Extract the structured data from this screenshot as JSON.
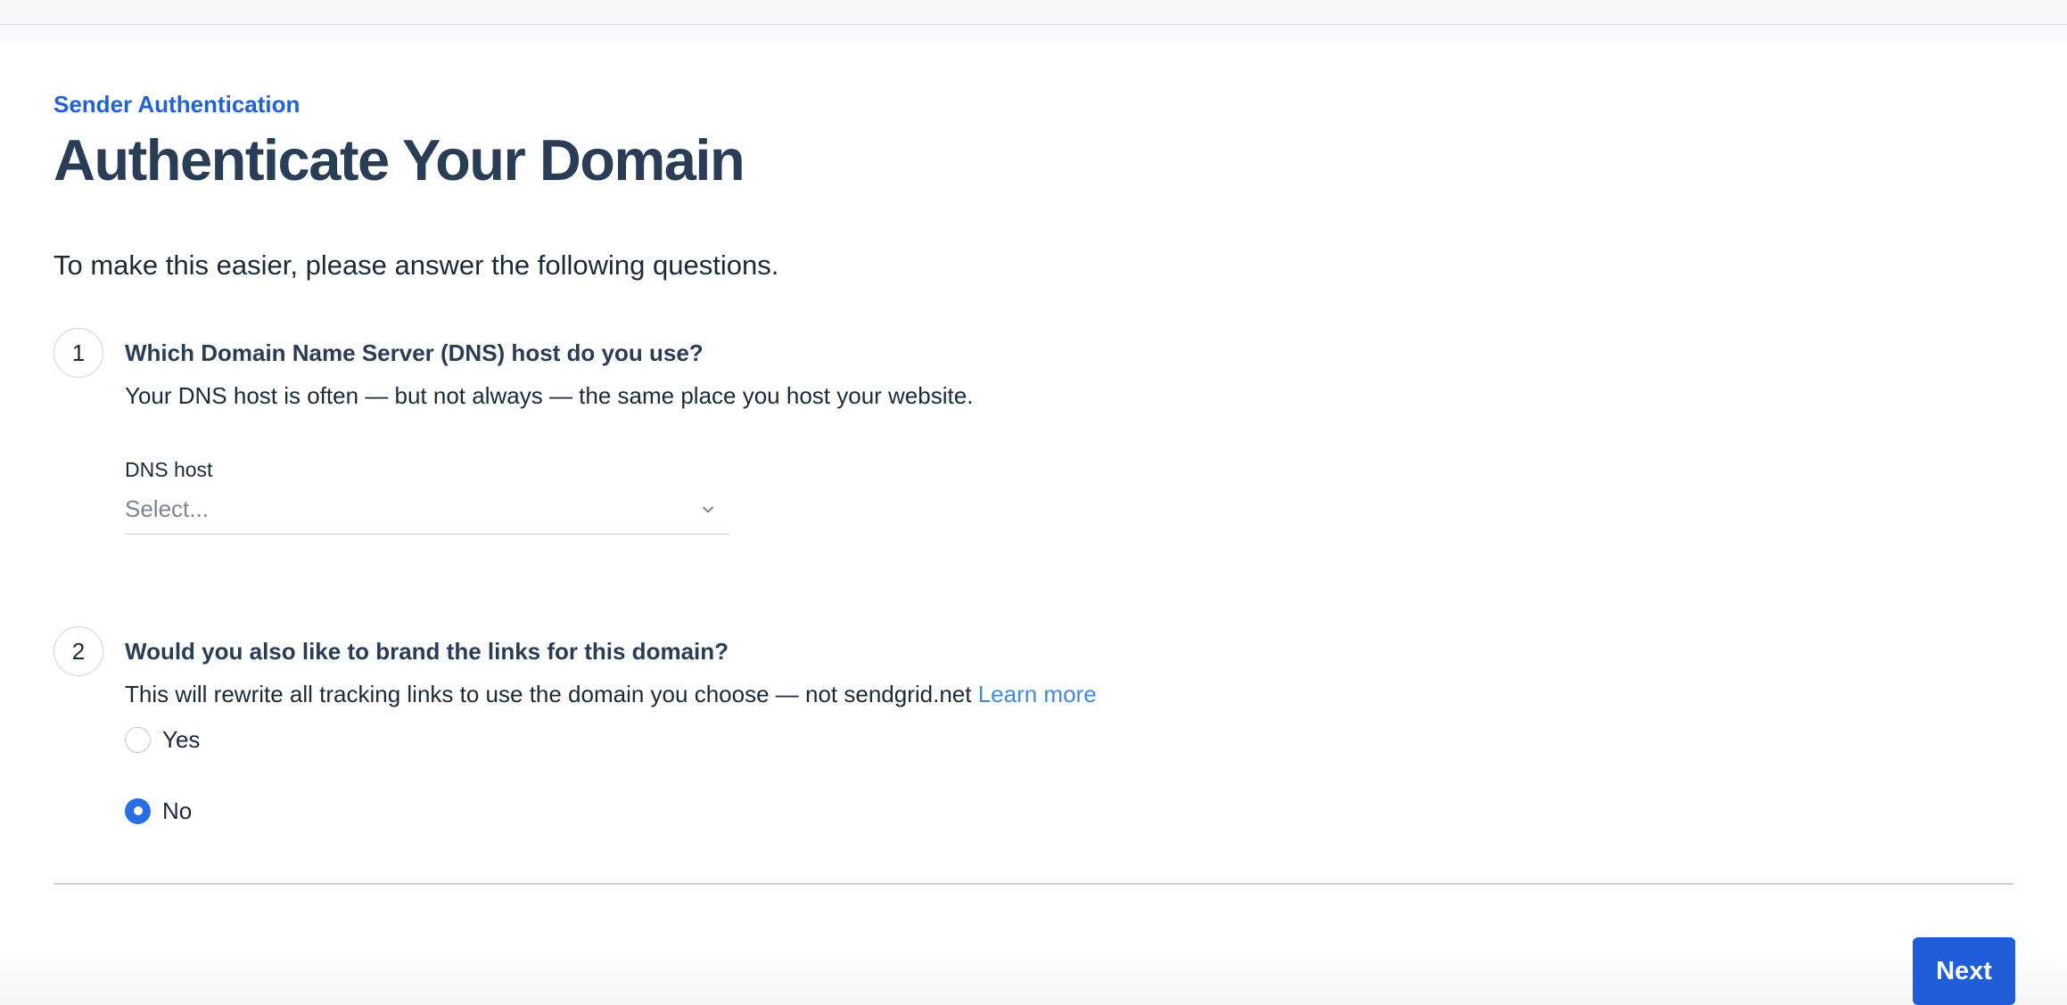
{
  "header": {
    "eyebrow": "Sender Authentication",
    "title": "Authenticate Your Domain"
  },
  "intro": "To make this easier, please answer the following questions.",
  "steps": [
    {
      "number": "1",
      "title": "Which Domain Name Server (DNS) host do you use?",
      "description": "Your DNS host is often — but not always — the same place you host your website.",
      "field_label": "DNS host",
      "select_placeholder": "Select...",
      "select_icon": "chevron-down-icon"
    },
    {
      "number": "2",
      "title": "Would you also like to brand the links for this domain?",
      "description": "This will rewrite all tracking links to use the domain you choose — not sendgrid.net",
      "link_text": "Learn more",
      "options": [
        {
          "label": "Yes",
          "checked": false
        },
        {
          "label": "No",
          "checked": true
        }
      ]
    }
  ],
  "footer": {
    "next_label": "Next"
  },
  "colors": {
    "accent": "#1f5ed8",
    "eyebrow": "#1f63d6",
    "heading": "#293d56",
    "link": "#3d8be0"
  }
}
